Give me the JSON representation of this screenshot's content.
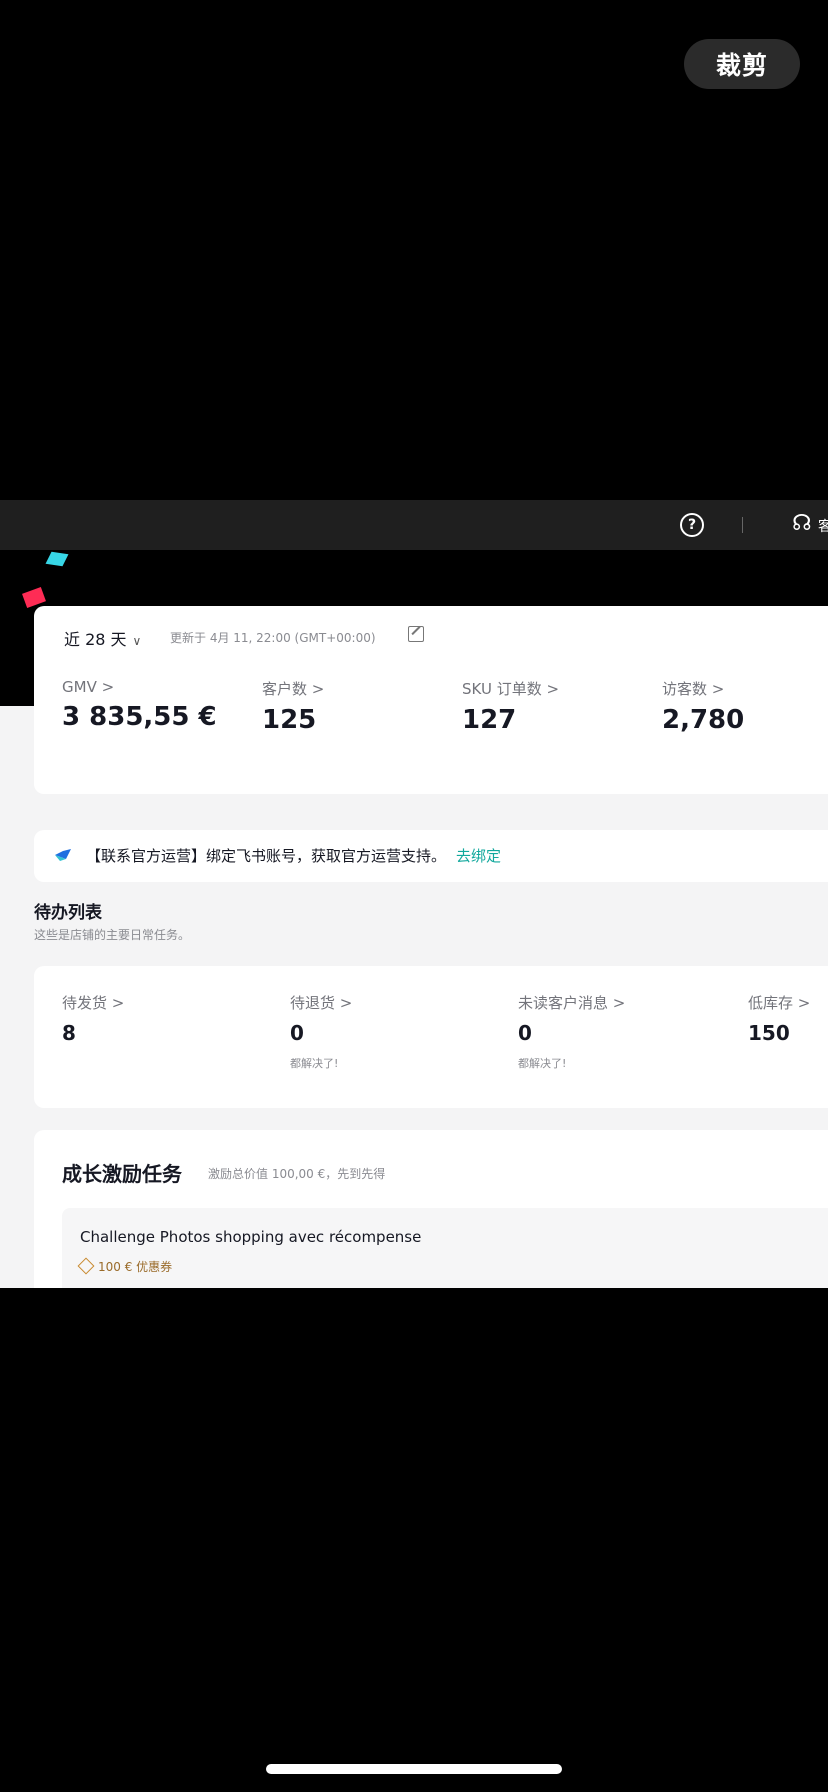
{
  "overlay": {
    "crop_label": "裁剪"
  },
  "topbar": {
    "help_glyph": "?",
    "cut_text": "客"
  },
  "metrics": {
    "range_label": "近 28 天",
    "updated": "更新于 4月 11, 22:00 (GMT+00:00)",
    "items": [
      {
        "label": "GMV >",
        "value": "3 835,55 €"
      },
      {
        "label": "客户数 >",
        "value": "125"
      },
      {
        "label": "SKU 订单数 >",
        "value": "127"
      },
      {
        "label": "访客数 >",
        "value": "2,780"
      }
    ]
  },
  "notice": {
    "text": "【联系官方运营】绑定飞书账号，获取官方运营支持。",
    "link": "去绑定"
  },
  "todo": {
    "title": "待办列表",
    "subtitle": "这些是店铺的主要日常任务。",
    "items": [
      {
        "label": "待发货 >",
        "value": "8",
        "note": ""
      },
      {
        "label": "待退货 >",
        "value": "0",
        "note": "都解决了!"
      },
      {
        "label": "未读客户消息 >",
        "value": "0",
        "note": "都解决了!"
      },
      {
        "label": "低库存 >",
        "value": "150",
        "note": ""
      }
    ]
  },
  "growth": {
    "title": "成长激励任务",
    "subtitle": "激励总价值 100,00 €，先到先得",
    "task": {
      "title": "Challenge Photos shopping avec récompense",
      "coupon": "100 € 优惠券"
    }
  },
  "colors": {
    "accent_link": "#12a89d",
    "brand_cyan": "#37d6e6",
    "brand_pink": "#fe2c55"
  }
}
